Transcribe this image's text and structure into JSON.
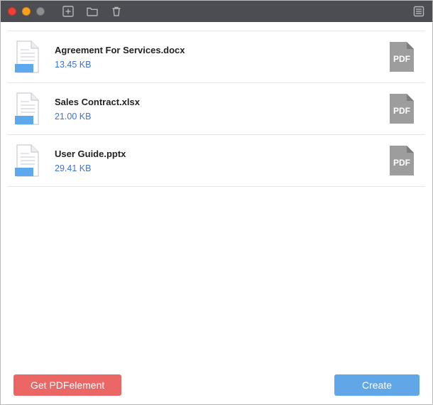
{
  "titlebar": {
    "icons": [
      "add-file-icon",
      "folder-icon",
      "trash-icon"
    ],
    "right_icon": "list-icon"
  },
  "files": [
    {
      "name": "Agreement For Services.docx",
      "size": "13.45 KB"
    },
    {
      "name": "Sales Contract.xlsx",
      "size": "21.00 KB"
    },
    {
      "name": "User Guide.pptx",
      "size": "29.41 KB"
    }
  ],
  "footer": {
    "get_label": "Get PDFelement",
    "create_label": "Create"
  },
  "badge_text": "PDF"
}
